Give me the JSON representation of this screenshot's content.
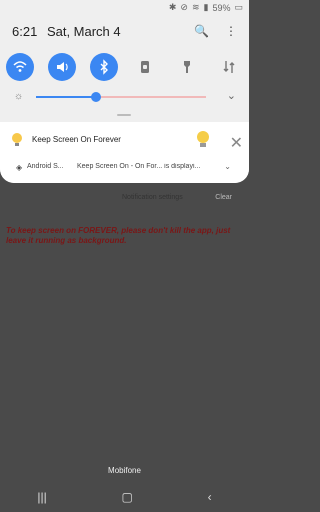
{
  "status_bar": {
    "battery": "59%"
  },
  "header": {
    "time": "6:21",
    "date": "Sat, March 4"
  },
  "quick_toggles": [
    {
      "name": "wifi",
      "active": true
    },
    {
      "name": "sound",
      "active": true
    },
    {
      "name": "bluetooth",
      "active": true
    },
    {
      "name": "portrait",
      "active": false
    },
    {
      "name": "flashlight",
      "active": false
    },
    {
      "name": "data",
      "active": false
    }
  ],
  "brightness": {
    "level": 0.35
  },
  "notification": {
    "app_name": "Keep Screen On Forever",
    "source": "Android S...",
    "message": "Keep Screen On - On For... is displayi..."
  },
  "actions": {
    "notification_settings": "Notification settings",
    "clear": "Clear"
  },
  "warning_text": "To keep screen on FOREVER, please don't kill the app, just leave it running as background.",
  "carrier": "Mobifone"
}
